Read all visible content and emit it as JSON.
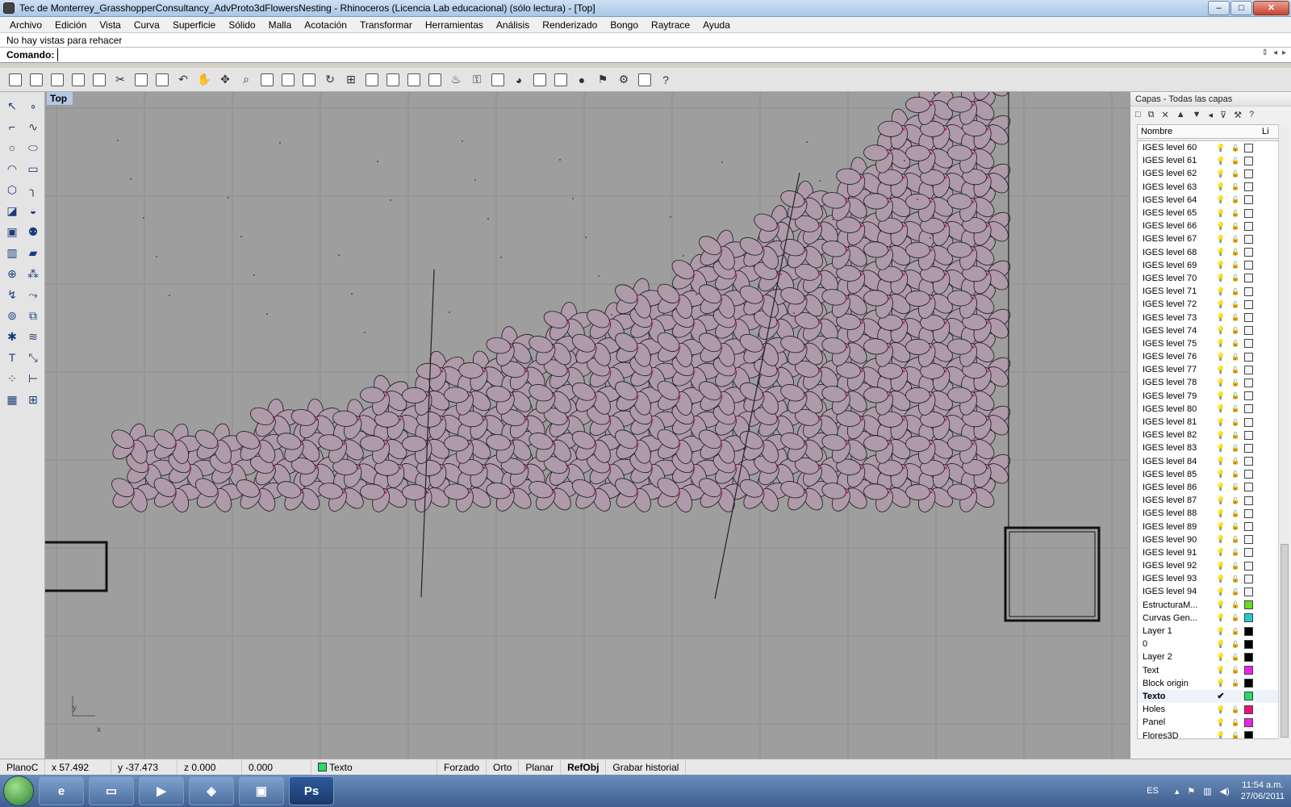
{
  "window": {
    "title": "Tec de Monterrey_GrasshopperConsultancy_AdvProto3dFlowersNesting - Rhinoceros (Licencia Lab educacional) (sólo lectura) - [Top]",
    "minimize": "–",
    "maximize": "□",
    "close": "✕"
  },
  "menu": [
    "Archivo",
    "Edición",
    "Vista",
    "Curva",
    "Superficie",
    "Sólido",
    "Malla",
    "Acotación",
    "Transformar",
    "Herramientas",
    "Análisis",
    "Renderizado",
    "Bongo",
    "Raytrace",
    "Ayuda"
  ],
  "command": {
    "history": "No hay vistas para rehacer",
    "label": "Comando:",
    "value": ""
  },
  "toolbar_icons": [
    "new-file-icon",
    "open-folder-icon",
    "save-icon",
    "print-icon",
    "import-icon",
    "cut-icon",
    "copy-icon",
    "paste-icon",
    "undo-icon",
    "pan-hand-icon",
    "move-view-icon",
    "zoom-icon",
    "zoom-window-icon",
    "zoom-extents-icon",
    "zoom-selected-icon",
    "rotate-view-icon",
    "four-viewports-icon",
    "car-icon",
    "shaded-icon",
    "select-points-icon",
    "snap-icon",
    "light-bulb-icon",
    "lock-icon",
    "layer-material-icon",
    "color-wheel-icon",
    "sphere-wireframe-icon",
    "render-settings-icon",
    "render-sphere-icon",
    "flag-icon",
    "gear-icon",
    "network-icon",
    "help-icon"
  ],
  "viewport": {
    "name": "Top",
    "axis_y": "y",
    "axis_x": "x"
  },
  "layers_panel": {
    "title": "Capas - Todas las capas",
    "column_name": "Nombre",
    "column_material": "Li",
    "rows": [
      {
        "name": "IGES level 60",
        "color": "#f4f4ff"
      },
      {
        "name": "IGES level 61",
        "color": "#f4f4ff"
      },
      {
        "name": "IGES level 62",
        "color": "#f4f4ff"
      },
      {
        "name": "IGES level 63",
        "color": "#f4f4ff"
      },
      {
        "name": "IGES level 64",
        "color": "#f4f4ff"
      },
      {
        "name": "IGES level 65",
        "color": "#f4f4ff"
      },
      {
        "name": "IGES level 66",
        "color": "#f4f4ff"
      },
      {
        "name": "IGES level 67",
        "color": "#f4f4ff"
      },
      {
        "name": "IGES level 68",
        "color": "#f4f4ff"
      },
      {
        "name": "IGES level 69",
        "color": "#f4f4ff"
      },
      {
        "name": "IGES level 70",
        "color": "#f4f4ff"
      },
      {
        "name": "IGES level 71",
        "color": "#f4f4ff"
      },
      {
        "name": "IGES level 72",
        "color": "#f4f4ff"
      },
      {
        "name": "IGES level 73",
        "color": "#f4f4ff"
      },
      {
        "name": "IGES level 74",
        "color": "#f4f4ff"
      },
      {
        "name": "IGES level 75",
        "color": "#f4f4ff"
      },
      {
        "name": "IGES level 76",
        "color": "#f4f4ff"
      },
      {
        "name": "IGES level 77",
        "color": "#f4f4ff"
      },
      {
        "name": "IGES level 78",
        "color": "#f4f4ff"
      },
      {
        "name": "IGES level 79",
        "color": "#f4f4ff"
      },
      {
        "name": "IGES level 80",
        "color": "#f4f4ff"
      },
      {
        "name": "IGES level 81",
        "color": "#f4f4ff"
      },
      {
        "name": "IGES level 82",
        "color": "#f4f4ff"
      },
      {
        "name": "IGES level 83",
        "color": "#f4f4ff"
      },
      {
        "name": "IGES level 84",
        "color": "#f4f4ff"
      },
      {
        "name": "IGES level 85",
        "color": "#f4f4ff"
      },
      {
        "name": "IGES level 86",
        "color": "#f4f4ff"
      },
      {
        "name": "IGES level 87",
        "color": "#f4f4ff"
      },
      {
        "name": "IGES level 88",
        "color": "#f4f4ff"
      },
      {
        "name": "IGES level 89",
        "color": "#f4f4ff"
      },
      {
        "name": "IGES level 90",
        "color": "#f4f4ff"
      },
      {
        "name": "IGES level 91",
        "color": "#f4f4ff"
      },
      {
        "name": "IGES level 92",
        "color": "#f4f4ff"
      },
      {
        "name": "IGES level 93",
        "color": "#f4f4ff"
      },
      {
        "name": "IGES level 94",
        "color": "#f4f4ff"
      },
      {
        "name": "EstructuraM...",
        "color": "#66dd22"
      },
      {
        "name": "Curvas Gen...",
        "color": "#22cccc"
      },
      {
        "name": "Layer 1",
        "color": "#000000"
      },
      {
        "name": "0",
        "color": "#000000"
      },
      {
        "name": "Layer 2",
        "color": "#000000"
      },
      {
        "name": "Text",
        "color": "#ee22ee"
      },
      {
        "name": "Block origin",
        "color": "#000000"
      },
      {
        "name": "Texto",
        "color": "#22dd66",
        "current": true,
        "check": "✔"
      },
      {
        "name": "Holes",
        "color": "#ee1177"
      },
      {
        "name": "Panel",
        "color": "#ee22ee"
      },
      {
        "name": "Flores3D",
        "color": "#000000"
      }
    ]
  },
  "statusbar": {
    "plane": "PlanoC",
    "x": "x 57.492",
    "y": "y -37.473",
    "z": "z 0.000",
    "extra": "0.000",
    "layer": "Texto",
    "layer_color": "#22dd66",
    "forzado": "Forzado",
    "orto": "Orto",
    "planar": "Planar",
    "refobj": "RefObj",
    "history": "Grabar historial"
  },
  "taskbar": {
    "ps_label": "Ps",
    "lang": "ES",
    "time": "11:54 a.m.",
    "date": "27/06/2011"
  }
}
